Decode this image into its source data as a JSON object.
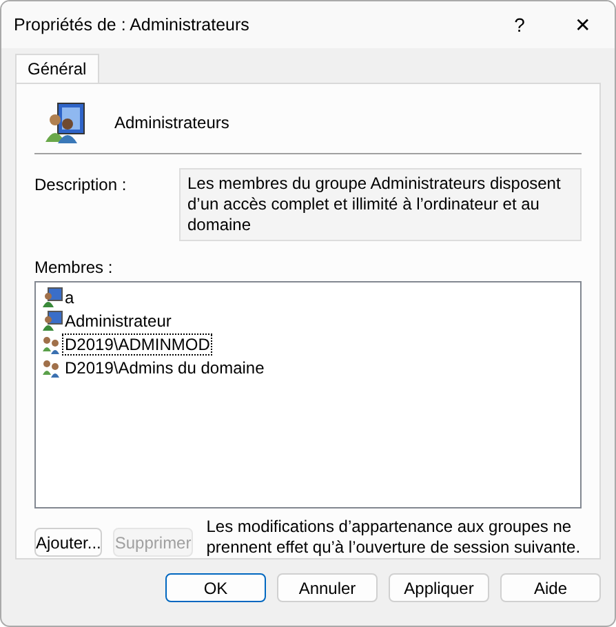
{
  "window": {
    "title": "Propriétés de : Administrateurs",
    "help": "?",
    "close": "✕"
  },
  "tabs": [
    {
      "label": "Général",
      "selected": true
    }
  ],
  "group": {
    "name": "Administrateurs"
  },
  "description": {
    "label": "Description :",
    "value": "Les membres du groupe Administrateurs disposent d’un accès complet et illimité à l’ordinateur et au domaine"
  },
  "members": {
    "label": "Membres :",
    "items": [
      {
        "name": "a",
        "kind": "user",
        "focused": false
      },
      {
        "name": "Administrateur",
        "kind": "user",
        "focused": false
      },
      {
        "name": "D2019\\ADMINMOD",
        "kind": "group",
        "focused": true
      },
      {
        "name": "D2019\\Admins du domaine",
        "kind": "group",
        "focused": false
      }
    ]
  },
  "actions": [
    {
      "label": "Ajouter...",
      "disabled": false
    },
    {
      "label": "Supprimer",
      "disabled": true
    }
  ],
  "note": "Les modifications d’appartenance aux groupes ne prennent effet qu’à l’ouverture de session suivante.",
  "buttons": [
    {
      "label": "OK",
      "default": true
    },
    {
      "label": "Annuler",
      "default": false
    },
    {
      "label": "Appliquer",
      "default": false
    },
    {
      "label": "Aide",
      "default": false
    }
  ]
}
